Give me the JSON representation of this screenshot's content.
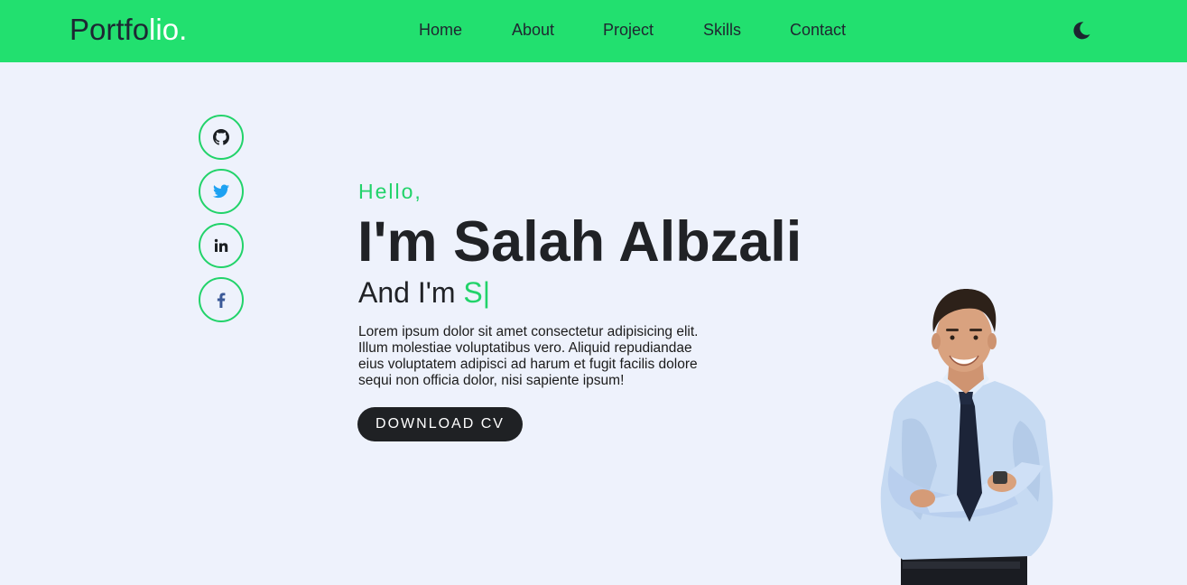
{
  "header": {
    "logo_main": "Portfo",
    "logo_highlight": "lio.",
    "nav": [
      {
        "label": "Home"
      },
      {
        "label": "About"
      },
      {
        "label": "Project"
      },
      {
        "label": "Skills"
      },
      {
        "label": "Contact"
      }
    ],
    "theme_icon": "moon-icon"
  },
  "socials": [
    {
      "icon": "github-icon"
    },
    {
      "icon": "twitter-icon"
    },
    {
      "icon": "linkedin-icon"
    },
    {
      "icon": "facebook-icon"
    }
  ],
  "hero": {
    "greeting": "Hello,",
    "name": "I'm Salah Albzali",
    "role_prefix": "And I'm ",
    "role_typed": "S|",
    "description": "Lorem ipsum dolor sit amet consectetur adipisicing elit. Illum molestiae voluptatibus vero. Aliquid repudiandae eius voluptatem adipisci ad harum et fugit facilis dolore sequi non officia dolor, nisi sapiente ipsum!",
    "button_label": "DOWNLOAD CV"
  },
  "colors": {
    "accent": "#22e06f",
    "accent_text": "#22d36a",
    "background": "#eef2fc",
    "dark": "#1f2124"
  }
}
